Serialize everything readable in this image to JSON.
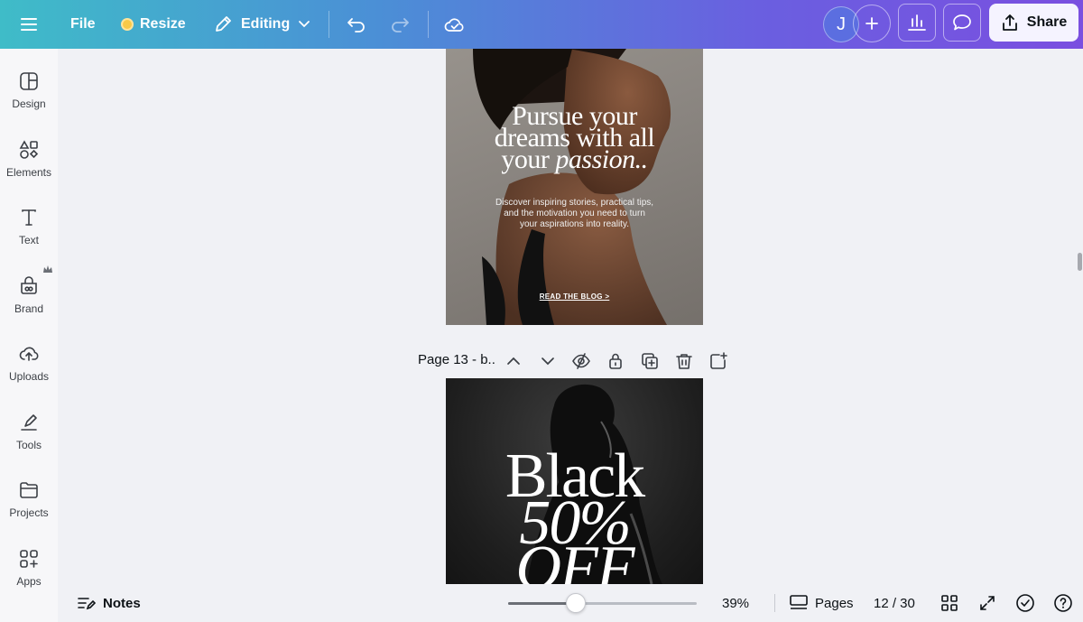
{
  "topbar": {
    "file_label": "File",
    "resize_label": "Resize",
    "mode_label": "Editing",
    "avatar_initial": "J",
    "share_label": "Share"
  },
  "sidebar": {
    "items": [
      {
        "label": "Design",
        "icon": "design-icon"
      },
      {
        "label": "Elements",
        "icon": "elements-icon"
      },
      {
        "label": "Text",
        "icon": "text-icon"
      },
      {
        "label": "Brand",
        "icon": "brand-icon"
      },
      {
        "label": "Uploads",
        "icon": "uploads-icon"
      },
      {
        "label": "Tools",
        "icon": "tools-icon"
      },
      {
        "label": "Projects",
        "icon": "projects-icon"
      },
      {
        "label": "Apps",
        "icon": "apps-icon"
      }
    ]
  },
  "canvas": {
    "page12": {
      "headline_line1": "Pursue your",
      "headline_line2": "dreams with all",
      "headline_line3a": "your",
      "headline_line3b": "passion..",
      "subtext_line1": "Discover inspiring stories, practical tips,",
      "subtext_line2": "and the motivation you need to turn",
      "subtext_line3": "your aspirations into reality.",
      "cta": "READ THE BLOG >"
    },
    "page13": {
      "title": "Page 13 - b..",
      "big_line1": "Black",
      "big_line2": "50%",
      "big_line3": "OFF"
    }
  },
  "bottombar": {
    "notes_label": "Notes",
    "zoom_level": "39%",
    "zoom_fraction": 0.36,
    "pages_label": "Pages",
    "page_counter": "12 / 30"
  },
  "colors": {
    "accent_start": "#3fbcc8",
    "accent_end": "#7a4fe0",
    "share_bg": "#f5f3ff"
  }
}
